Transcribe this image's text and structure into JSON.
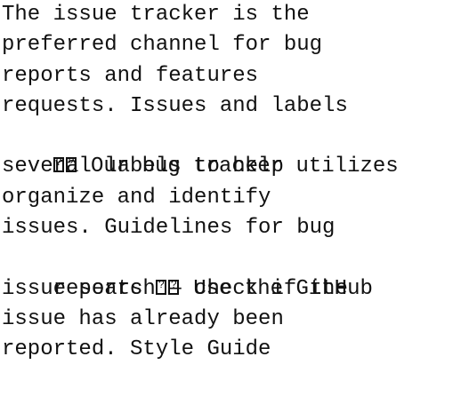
{
  "document": {
    "lines": [
      "The issue tracker is the",
      "preferred channel for bug",
      "reports and features",
      "requests. Issues and labels",
      "Our bug tracker utilizes",
      "several labels to help",
      "organize and identify",
      "issues. Guidelines for bug",
      "reports",
      "Use the GitHub",
      "issue search — check if the",
      "issue has already been",
      "reported. Style Guide"
    ]
  }
}
